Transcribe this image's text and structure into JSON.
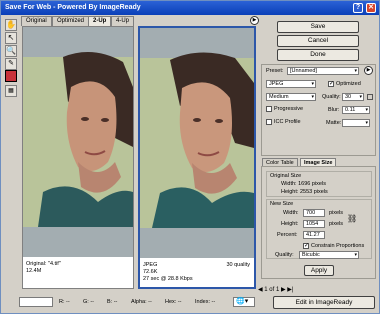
{
  "window": {
    "title": "Save For Web - Powered By ImageReady",
    "help_glyph": "?",
    "close_glyph": "✕"
  },
  "tabs": [
    "Original",
    "Optimized",
    "2-Up",
    "4-Up"
  ],
  "panes": {
    "left": {
      "line1": "Original: \"4.tif\"",
      "line2": "12.4M"
    },
    "right": {
      "line1": "JPEG",
      "line2": "72.6K",
      "line3": "27 sec @ 28.8 Kbps",
      "quality": "30 quality"
    }
  },
  "buttons": {
    "save": "Save",
    "cancel": "Cancel",
    "done": "Done",
    "apply": "Apply",
    "edit": "Edit in ImageReady"
  },
  "settings": {
    "preset_label": "Preset:",
    "preset_value": "[Unnamed]",
    "format": "JPEG",
    "optimized_label": "Optimized",
    "optimized_checked": true,
    "quality_level": "Medium",
    "quality_label": "Quality:",
    "quality_value": "30",
    "progressive_label": "Progressive",
    "progressive_checked": false,
    "blur_label": "Blur:",
    "blur_value": "0.11",
    "icc_label": "ICC Profile",
    "icc_checked": false,
    "matte_label": "Matte:",
    "matte_value": ""
  },
  "inner_tabs": [
    "Color Table",
    "Image Size"
  ],
  "image_size": {
    "original_title": "Original Size",
    "orig_width": "Width: 1696 pixels",
    "orig_height": "Height: 2553 pixels",
    "new_title": "New Size",
    "width_label": "Width:",
    "width_value": "700",
    "width_unit": "pixels",
    "height_label": "Height:",
    "height_value": "1054",
    "height_unit": "pixels",
    "percent_label": "Percent:",
    "percent_value": "41.27",
    "constrain_label": "Constrain Proportions",
    "constrain_checked": true,
    "quality_label": "Quality:",
    "quality_value": "Bicubic"
  },
  "status": {
    "zoom": "",
    "r": "R: --",
    "g": "G: --",
    "b": "B: --",
    "alpha": "Alpha: --",
    "hex": "Hex: --",
    "index": "Index: --",
    "page": "1 of 1"
  },
  "colors": {
    "accent": "#2d57a9",
    "title_bar": "#0a3fb8",
    "swatch": "#c8323a"
  }
}
